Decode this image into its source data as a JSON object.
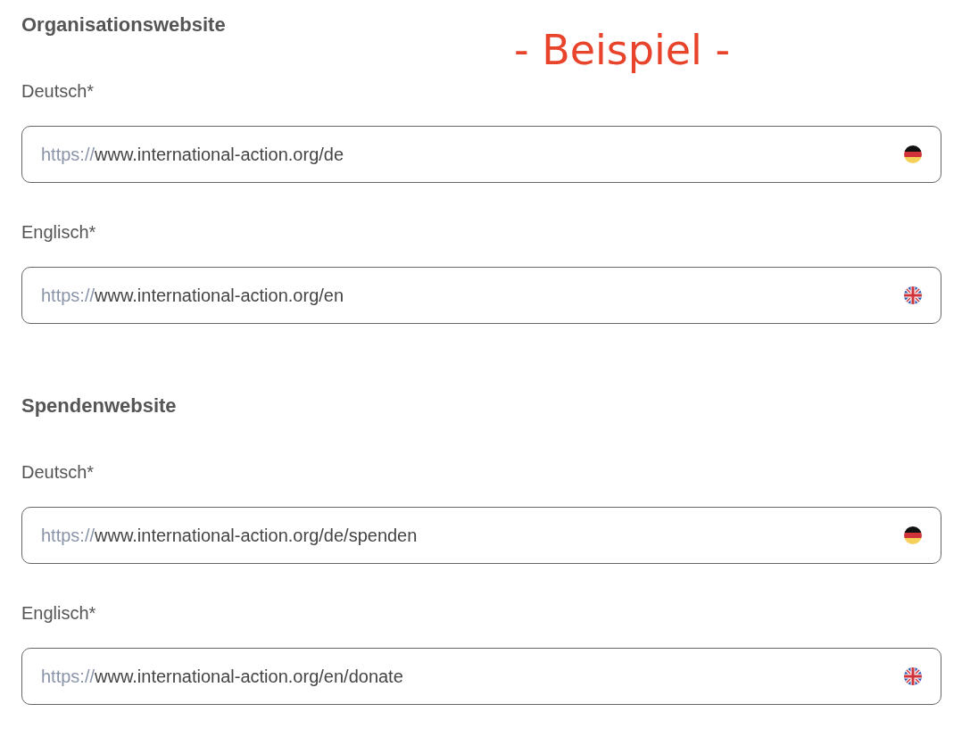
{
  "annotation": "- Beispiel -",
  "sections": [
    {
      "title": "Organisationswebsite",
      "fields": [
        {
          "label": "Deutsch*",
          "prefix": "https://",
          "value": "www.international-action.org/de",
          "kind": "german"
        },
        {
          "label": "Englisch*",
          "prefix": "https://",
          "value": "www.international-action.org/en",
          "kind": "english"
        }
      ]
    },
    {
      "title": "Spendenwebsite",
      "fields": [
        {
          "label": "Deutsch*",
          "prefix": "https://",
          "value": "www.international-action.org/de/spenden",
          "kind": "german"
        },
        {
          "label": "Englisch*",
          "prefix": "https://",
          "value": "www.international-action.org/en/donate",
          "kind": "english"
        }
      ]
    }
  ]
}
